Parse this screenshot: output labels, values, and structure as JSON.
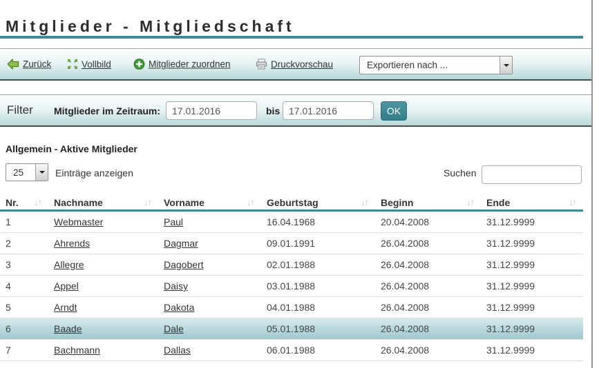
{
  "window": {
    "title": "Mitglieder - Mitgliedschaft"
  },
  "toolbar": {
    "back_label": "Zurück",
    "fullscreen_label": "Vollbild",
    "assign_label": "Mitglieder zuordnen",
    "print_label": "Druckvorschau",
    "export_select_value": "Exportieren nach ..."
  },
  "filter": {
    "title": "Filter",
    "period_label": "Mitglieder im Zeitraum:",
    "date_from": "17.01.2016",
    "between_label": "bis",
    "date_to": "17.01.2016",
    "ok_label": "OK"
  },
  "section": {
    "title": "Allgemein - Aktive Mitglieder"
  },
  "list_controls": {
    "page_size_value": "25",
    "entries_label": "Einträge anzeigen",
    "search_label": "Suchen",
    "search_value": ""
  },
  "table": {
    "columns": [
      "Nr.",
      "Nachname",
      "Vorname",
      "Geburtstag",
      "Beginn",
      "Ende"
    ],
    "rows": [
      {
        "nr": "1",
        "nachname": "Webmaster",
        "vorname": "Paul",
        "geburtstag": "16.04.1968",
        "beginn": "20.04.2008",
        "ende": "31.12.9999"
      },
      {
        "nr": "2",
        "nachname": "Ahrends",
        "vorname": "Dagmar",
        "geburtstag": "09.01.1991",
        "beginn": "26.04.2008",
        "ende": "31.12.9999"
      },
      {
        "nr": "3",
        "nachname": "Allegre",
        "vorname": "Dagobert",
        "geburtstag": "02.01.1988",
        "beginn": "26.04.2008",
        "ende": "31.12.9999"
      },
      {
        "nr": "4",
        "nachname": "Appel",
        "vorname": "Daisy",
        "geburtstag": "03.01.1988",
        "beginn": "26.04.2008",
        "ende": "31.12.9999"
      },
      {
        "nr": "5",
        "nachname": "Arndt",
        "vorname": "Dakota",
        "geburtstag": "04.01.1988",
        "beginn": "26.04.2008",
        "ende": "31.12.9999"
      },
      {
        "nr": "6",
        "nachname": "Baade",
        "vorname": "Dale",
        "geburtstag": "05.01.1988",
        "beginn": "26.04.2008",
        "ende": "31.12.9999"
      },
      {
        "nr": "7",
        "nachname": "Bachmann",
        "vorname": "Dallas",
        "geburtstag": "06.01.1988",
        "beginn": "26.04.2008",
        "ende": "31.12.9999"
      }
    ],
    "highlighted_row": 6
  },
  "icons": {
    "sort": "↓↑"
  },
  "colors": {
    "accent_teal": "#3a8b96",
    "bar_gradient_bottom": "#b7d7d9",
    "highlight_row_bottom": "#9fc8cf",
    "icon_green": "#5ba33c",
    "border_dark": "#4a4a4a"
  }
}
